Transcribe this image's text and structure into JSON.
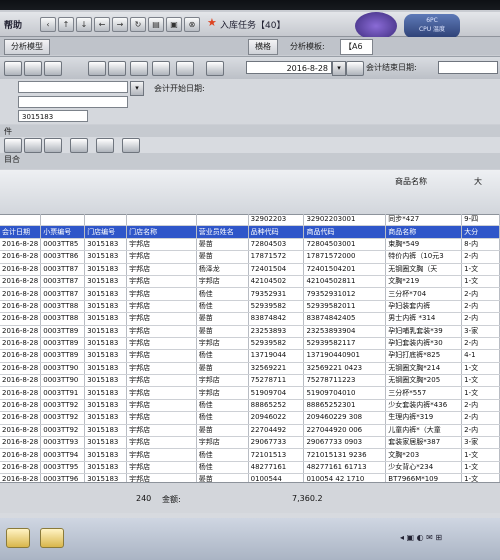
{
  "toolbar": {
    "title": "帮助",
    "app_title": "入库任务【40】"
  },
  "badge": {
    "clock": "",
    "cpu_line1": "6PC",
    "cpu_line2": "CPU 温度"
  },
  "tabs": {
    "detail": "横格",
    "analysis": "分析模板:",
    "analysis_value": "【A6",
    "checkbox_label": "分析模型"
  },
  "dates": {
    "start": "2016-8-28",
    "start_label": "会计开始日期:",
    "end_label": "会计结束日期:"
  },
  "filters": {
    "store_code": "3015183",
    "section_label": "件",
    "section2_label": "目合"
  },
  "grid": {
    "group_header_1": "商品名称",
    "group_header_2": "大",
    "columns": [
      "会计日期",
      "小票编号",
      "门店编号",
      "门店名称",
      "营业员姓名",
      "品种代码",
      "商品代码",
      "商品名称",
      "大分"
    ],
    "top_row": [
      "",
      "",
      "",
      "",
      "",
      "32902203",
      "32902203001",
      "同步*427",
      "9-四"
    ],
    "rows": [
      [
        "2016-8-28",
        "0003TT85",
        "3015183",
        "宇邦店",
        "晏苗",
        "72804503",
        "72804503001",
        "束胸*549",
        "8-内"
      ],
      [
        "2016-8-28",
        "0003TT86",
        "3015183",
        "宇邦店",
        "晏苗",
        "17871572",
        "17871572000",
        "特价内裤（10元3",
        "2-内"
      ],
      [
        "2016-8-28",
        "0003TT87",
        "3015183",
        "宇邦店",
        "杨泽龙",
        "72401504",
        "72401504201",
        "无钢圈文胸（天",
        "1-文"
      ],
      [
        "2016-8-28",
        "0003TT87",
        "3015183",
        "宇邦店",
        "宇邦店",
        "42104502",
        "42104502811",
        "文胸*219",
        "1-文"
      ],
      [
        "2016-8-28",
        "0003TT87",
        "3015183",
        "宇邦店",
        "杨佳",
        "79352931",
        "79352931012",
        "三分杯*704",
        "2-内"
      ],
      [
        "2016-8-28",
        "0003TT88",
        "3015183",
        "宇邦店",
        "杨佳",
        "52939582",
        "52939582011",
        "孕妇装套内裤",
        "2-内"
      ],
      [
        "2016-8-28",
        "0003TT88",
        "3015183",
        "宇邦店",
        "晏苗",
        "83874842",
        "83874842405",
        "男士内裤 *314",
        "2-内"
      ],
      [
        "2016-8-28",
        "0003TT89",
        "3015183",
        "宇邦店",
        "晏苗",
        "23253893",
        "23253893904",
        "孕妇哺乳套装*39",
        "3-家"
      ],
      [
        "2016-8-28",
        "0003TT89",
        "3015183",
        "宇邦店",
        "宇邦店",
        "52939582",
        "52939582117",
        "孕妇套装内裤*30",
        "2-内"
      ],
      [
        "2016-8-28",
        "0003TT89",
        "3015183",
        "宇邦店",
        "杨佳",
        "13719044",
        "137190440901",
        "孕妇打底裤*825",
        "4-1"
      ],
      [
        "2016-8-28",
        "0003TT90",
        "3015183",
        "宇邦店",
        "晏苗",
        "32569221",
        "32569221 0423",
        "无钢圈文胸*214",
        "1-文"
      ],
      [
        "2016-8-28",
        "0003TT90",
        "3015183",
        "宇邦店",
        "宇邦店",
        "75278711",
        "75278711223",
        "无钢圈文胸*205",
        "1-文"
      ],
      [
        "2016-8-28",
        "0003TT91",
        "3015183",
        "宇邦店",
        "宇邦店",
        "51909704",
        "51909704010",
        "三分杯*557",
        "1-文"
      ],
      [
        "2016-8-28",
        "0003TT92",
        "3015183",
        "宇邦店",
        "杨佳",
        "88865252",
        "88865252301",
        "少女套装内裤*436",
        "2-内"
      ],
      [
        "2016-8-28",
        "0003TT92",
        "3015183",
        "宇邦店",
        "杨佳",
        "20946022",
        "209460229 308",
        "生理内裤*319",
        "2-内"
      ],
      [
        "2016-8-28",
        "0003TT92",
        "3015183",
        "宇邦店",
        "晏苗",
        "22704492",
        "227044920 006",
        "儿童内裤*（大童",
        "2-内"
      ],
      [
        "2016-8-28",
        "0003TT93",
        "3015183",
        "宇邦店",
        "宇邦店",
        "29067733",
        "29067733 0903",
        "套装家居服*387",
        "3-家"
      ],
      [
        "2016-8-28",
        "0003TT94",
        "3015183",
        "宇邦店",
        "杨佳",
        "72101513",
        "721015131 9236",
        "文胸*203",
        "1-文"
      ],
      [
        "2016-8-28",
        "0003TT95",
        "3015183",
        "宇邦店",
        "杨佳",
        "48277161",
        "48277161 61713",
        "少女背心*234",
        "1-文"
      ],
      [
        "2016-8-28",
        "0003TT96",
        "3015183",
        "宇邦店",
        "晏苗",
        "0100544",
        "010054 42 1710",
        "BT7966M*109",
        "1-文"
      ],
      [
        "2016-8-28",
        "0003TT97",
        "3015183",
        "宇邦店",
        "杨佳",
        "59623872",
        "59623872 0401",
        "套装内裤*325",
        "2-内"
      ],
      [
        "2016-8-28",
        "0003TT98",
        "3015183",
        "宇邦店",
        "杨佳",
        "79352931",
        "79352931 0114",
        "文胸*219",
        "1-文"
      ],
      [
        "2016-8-28",
        "0003TT99",
        "3015183",
        "宇邦店",
        "杨佳",
        "23703051",
        "23703051 0413",
        "文胸*201",
        "1-文"
      ],
      [
        "2016-8-28",
        "0003TT09",
        "3015183",
        "宇邦店",
        "宇邦店",
        "79352931",
        "79352931 0112",
        "文胸*219",
        "1-文"
      ]
    ]
  },
  "status": {
    "count": "240",
    "amount_label": "金额:",
    "amount": "7,360.2"
  }
}
